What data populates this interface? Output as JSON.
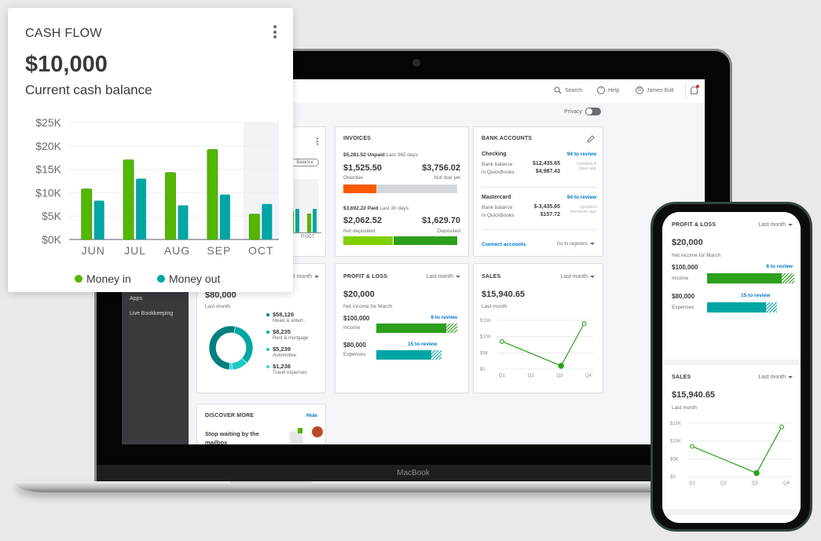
{
  "laptop": {
    "brand_label": "MacBook",
    "topbar": {
      "search_label": "Search",
      "help_label": "Help",
      "user_name": "James Bolt",
      "privacy_label": "Privacy",
      "privacy_on": false
    },
    "sidebar": {
      "items": [
        {
          "label": "Apps"
        },
        {
          "label": "Live Bookkeeping"
        }
      ]
    },
    "cashflow_card_partial": {
      "balance_chip": "Balance",
      "visible_month": "OCT",
      "partial_tick": "P"
    },
    "invoices": {
      "title": "INVOICES",
      "unpaid_amount": "$5,281.52 Unpaid",
      "unpaid_period": "Last 365 days",
      "overdue_amount": "$1,525.50",
      "overdue_label": "Overdue",
      "not_due_amount": "$3,756.02",
      "not_due_label": "Not due yet",
      "overdue_fraction": 0.29,
      "paid_amount": "$3,692.22 Paid",
      "paid_period": "Last 30 days",
      "not_deposited_amount": "$2,062.52",
      "not_deposited_label": "Not deposited",
      "deposited_amount": "$1,629.70",
      "deposited_label": "Deposited",
      "not_deposited_fraction": 0.44,
      "colors": {
        "overdue": "#ff5a00",
        "not_due": "#d4d7dc",
        "not_deposited": "#7fd000",
        "deposited": "#2ca01c"
      }
    },
    "bank_accounts": {
      "title": "BANK ACCOUNTS",
      "accounts": [
        {
          "name": "Checking",
          "review": "94 to review",
          "bank_label": "Bank balance",
          "bank_value": "$12,435.65",
          "qb_label": "in QuickBooks",
          "qb_value": "$4,987.43",
          "updated_1": "Updated 4",
          "updated_2": "days ago"
        },
        {
          "name": "Mastercard",
          "review": "94 to review",
          "bank_label": "Bank balance",
          "bank_value": "$-3,435.65",
          "qb_label": "in QuickBooks",
          "qb_value": "$157.72",
          "updated_1": "Updated",
          "updated_2": "moments ago"
        }
      ],
      "connect_label": "Connect accounts",
      "registers_label": "Go to registers"
    },
    "expenses": {
      "period": "Last month",
      "amount": "$80,000",
      "sub": "Last month",
      "items": [
        {
          "value": "$58,126",
          "label": "Meals & entert...",
          "color": "#00807f",
          "share": 58126
        },
        {
          "value": "$8,235",
          "label": "Rent & mortgage",
          "color": "#00a6a4",
          "share": 8235
        },
        {
          "value": "$5,239",
          "label": "Automotive",
          "color": "#1ec8c6",
          "share": 5239
        },
        {
          "value": "$1,238",
          "label": "Travel expenses",
          "color": "#2fd9d6",
          "share": 1238
        }
      ]
    },
    "profit_loss": {
      "title": "PROFIT & LOSS",
      "period": "Last month",
      "amount": "$20,000",
      "sub": "Net income for March",
      "income_amount": "$100,000",
      "income_label": "Income",
      "income_review": "8 to review",
      "expenses_amount": "$80,000",
      "expenses_label": "Expenses",
      "expenses_review": "15 to review"
    },
    "sales": {
      "title": "SALES",
      "period": "Last month",
      "amount": "$15,940.65",
      "sub": "Last month"
    },
    "discover": {
      "title": "DISCOVER MORE",
      "hide_label": "Hide",
      "headline": "Stop waiting by the mailbox"
    }
  },
  "phone": {
    "profit_loss": {
      "title": "PROFIT & LOSS",
      "period": "Last month",
      "amount": "$20,000",
      "sub": "Net income for March",
      "income_amount": "$100,000",
      "income_label": "Income",
      "income_review": "8 to review",
      "expenses_amount": "$80,000",
      "expenses_label": "Expenses",
      "expenses_review": "15 to review"
    },
    "sales": {
      "title": "SALES",
      "period": "Last month",
      "amount": "$15,940.65",
      "sub": "Last month"
    }
  },
  "cashflow": {
    "title": "CASH FLOW",
    "amount": "$10,000",
    "sub": "Current cash balance"
  },
  "chart_data": [
    {
      "type": "bar",
      "title": "CASH FLOW",
      "categories": [
        "JUN",
        "JUL",
        "AUG",
        "SEP",
        "OCT"
      ],
      "series": [
        {
          "name": "Money in",
          "color": "#53b700",
          "values": [
            10800,
            17000,
            14300,
            19200,
            5400
          ]
        },
        {
          "name": "Money out",
          "color": "#00a6a4",
          "values": [
            8300,
            13000,
            7300,
            9600,
            7600
          ]
        }
      ],
      "yticks": [
        "$0K",
        "$5K",
        "$10K",
        "$15K",
        "$20K",
        "$25K"
      ],
      "ylim": [
        0,
        25000
      ],
      "highlighted_category": "OCT",
      "grid": true,
      "legend": "bottom"
    },
    {
      "type": "line",
      "title": "SALES",
      "categories": [
        "Q1",
        "Q2",
        "Q3",
        "Q4"
      ],
      "x": [
        1,
        2.5,
        3,
        3.7
      ],
      "values": [
        8500,
        null,
        1000,
        14000
      ],
      "points": [
        {
          "x": 0.0,
          "y": 8500,
          "filled": false
        },
        {
          "x": 2.05,
          "y": 1000,
          "filled": true
        },
        {
          "x": 2.85,
          "y": 14000,
          "filled": false
        }
      ],
      "yticks": [
        "$0",
        "$5K",
        "$10K",
        "$15K"
      ],
      "ylim": [
        0,
        15000
      ],
      "xlim": [
        0,
        3
      ],
      "color": "#2ca01c",
      "grid": true
    }
  ]
}
